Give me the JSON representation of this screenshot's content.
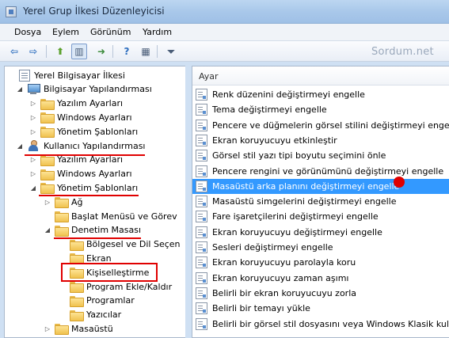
{
  "window": {
    "title": "Yerel Grup İlkesi Düzenleyicisi"
  },
  "menu": {
    "items": [
      "Dosya",
      "Eylem",
      "Görünüm",
      "Yardım"
    ]
  },
  "toolbar": {
    "buttons": [
      {
        "name": "back-arrow-icon",
        "glyph": "⇦",
        "color": "#2f6fbf"
      },
      {
        "name": "forward-arrow-icon",
        "glyph": "⇨",
        "color": "#2f6fbf"
      },
      {
        "name": "up-folder-icon",
        "glyph": "⬆",
        "color": "#5aa02c"
      },
      {
        "name": "show-hide-tree-icon",
        "glyph": "▥",
        "color": "#4a5d78"
      },
      {
        "name": "export-list-icon",
        "glyph": "➜",
        "color": "#3d8c3d"
      },
      {
        "name": "help-icon",
        "glyph": "?",
        "color": "#2f6fbf"
      },
      {
        "name": "properties-icon",
        "glyph": "▦",
        "color": "#4a5d78"
      },
      {
        "name": "filter-icon",
        "glyph": "⏷",
        "color": "#4a5d78"
      }
    ],
    "watermark": "Sordum.net"
  },
  "tree": {
    "items": [
      {
        "label": "Yerel Bilgisayar İlkesi",
        "icon": "policy",
        "expander": ""
      },
      {
        "label": "Bilgisayar Yapılandırması",
        "icon": "computer",
        "expander": "◢"
      },
      {
        "label": "Yazılım Ayarları",
        "icon": "folder",
        "expander": "▷"
      },
      {
        "label": "Windows Ayarları",
        "icon": "folder",
        "expander": "▷"
      },
      {
        "label": "Yönetim Şablonları",
        "icon": "folder",
        "expander": "▷"
      },
      {
        "label": "Kullanıcı Yapılandırması",
        "icon": "user",
        "expander": "◢"
      },
      {
        "label": "Yazılım Ayarları",
        "icon": "folder",
        "expander": "▷"
      },
      {
        "label": "Windows Ayarları",
        "icon": "folder",
        "expander": "▷"
      },
      {
        "label": "Yönetim Şablonları",
        "icon": "folder",
        "expander": "◢"
      },
      {
        "label": "Ağ",
        "icon": "folder",
        "expander": "▷"
      },
      {
        "label": "Başlat Menüsü ve Görev",
        "icon": "folder",
        "expander": ""
      },
      {
        "label": "Denetim Masası",
        "icon": "folder",
        "expander": "◢"
      },
      {
        "label": "Bölgesel ve Dil Seçen",
        "icon": "folder",
        "expander": ""
      },
      {
        "label": "Ekran",
        "icon": "folder",
        "expander": ""
      },
      {
        "label": "Kişiselleştirme",
        "icon": "folder",
        "expander": ""
      },
      {
        "label": "Program Ekle/Kaldır",
        "icon": "folder",
        "expander": ""
      },
      {
        "label": "Programlar",
        "icon": "folder",
        "expander": ""
      },
      {
        "label": "Yazıcılar",
        "icon": "folder",
        "expander": ""
      },
      {
        "label": "Masaüstü",
        "icon": "folder",
        "expander": "▷"
      }
    ]
  },
  "list": {
    "header": "Ayar",
    "rows": [
      {
        "label": "Renk düzenini değiştirmeyi engelle",
        "selected": false
      },
      {
        "label": "Tema değiştirmeyi engelle",
        "selected": false
      },
      {
        "label": "Pencere ve düğmelerin görsel stilini değiştirmeyi engelle",
        "selected": false
      },
      {
        "label": "Ekran koruyucuyu etkinleştir",
        "selected": false
      },
      {
        "label": "Görsel stil yazı tipi boyutu seçimini önle",
        "selected": false
      },
      {
        "label": "Pencere rengini ve görünümünü değiştirmeyi engelle",
        "selected": false
      },
      {
        "label": "Masaüstü arka planını değiştirmeyi engelle",
        "selected": true
      },
      {
        "label": "Masaüstü simgelerini değiştirmeyi engelle",
        "selected": false
      },
      {
        "label": "Fare işaretçilerini değiştirmeyi engelle",
        "selected": false
      },
      {
        "label": "Ekran koruyucuyu değiştirmeyi engelle",
        "selected": false
      },
      {
        "label": "Sesleri değiştirmeyi engelle",
        "selected": false
      },
      {
        "label": "Ekran koruyucuyu parolayla koru",
        "selected": false
      },
      {
        "label": "Ekran koruyucuyu zaman aşımı",
        "selected": false
      },
      {
        "label": "Belirli bir ekran koruyucuyu zorla",
        "selected": false
      },
      {
        "label": "Belirli bir temayı yükle",
        "selected": false
      },
      {
        "label": "Belirli bir görsel stil dosyasını veya Windows Klasik kullanı",
        "selected": false
      }
    ]
  },
  "colors": {
    "annotation_red": "#e00000",
    "selection_blue": "#3399ff"
  }
}
